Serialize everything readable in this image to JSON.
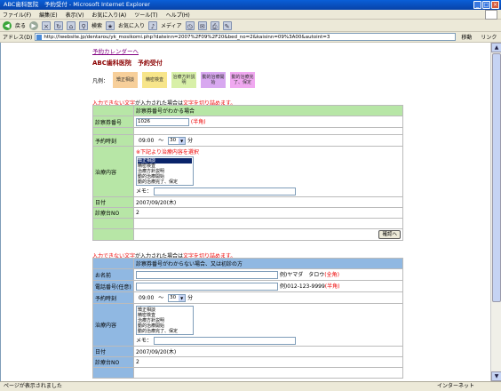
{
  "window": {
    "title": "ABC歯科医院　予約受付 - Microsoft Internet Explorer",
    "menus": [
      "ファイル(F)",
      "編集(E)",
      "表示(V)",
      "お気に入り(A)",
      "ツール(T)",
      "ヘルプ(H)"
    ],
    "toolbar": {
      "back": "戻る",
      "search": "検索",
      "favorites": "お気に入り",
      "media": "メディア"
    },
    "address_label": "アドレス(D)",
    "address": "http://lwebsite.jp/dentarou/yk_mosikomi.php?dateinn=2007%2F09%2F20&bed_no=2&kaisinn=09%3A00&autoint=3",
    "go": "移動",
    "links": "リンク",
    "status": "ページが表示されました",
    "zone": "インターネット"
  },
  "page": {
    "calendar_link": "予約カレンダーへ",
    "clinic_title": "ABC歯科医院　予約受付",
    "legend_label": "凡例：",
    "legend": [
      {
        "label": "矯正相談",
        "color": "#f7cf9a"
      },
      {
        "label": "精密検査",
        "color": "#f7e58a"
      },
      {
        "label": "治療方針説明",
        "color": "#d8f0a8"
      },
      {
        "label": "動的治療開始",
        "color": "#d8a8f0"
      },
      {
        "label": "動的治療完了、保定",
        "color": "#f0a8f0"
      }
    ],
    "warning_pre": "入力できない文字",
    "warning_mid": "が入力された場合は",
    "warning_red": "文字を切り詰めます。",
    "form1": {
      "header": "診察券番号がわかる場合",
      "card_label": "診察券番号",
      "card_value": "1026",
      "card_note": "(半角)",
      "time_label": "予約時刻",
      "time_hour": "09:00",
      "time_sep": "～",
      "time_min": "30",
      "time_unit": "分",
      "treat_label": "治療内容",
      "treat_note": "※下記より治療内容を選択",
      "options": [
        "矯正相談",
        "精密検査",
        "治療方針説明",
        "動的治療開始",
        "動的治療完了、保定"
      ],
      "memo_label": "メモ：",
      "date_label": "日付",
      "date_value": "2007/09/20(木)",
      "bed_label": "診療台NO",
      "bed_value": "2",
      "confirm_button": "確認へ"
    },
    "form2": {
      "header": "診察券番号がわからない場合、又は初診の方",
      "name_label": "お名前",
      "name_example": "例)ヤマダ　タロウ",
      "name_note": "(全角)",
      "phone_label": "電話番号(任意)",
      "phone_example": "例)012-123-9999",
      "phone_note": "(半角)",
      "time_label": "予約時刻",
      "time_hour": "09:00",
      "time_sep": "～",
      "time_min": "30",
      "time_unit": "分",
      "treat_label": "治療内容",
      "options": [
        "矯正相談",
        "精密検査",
        "治療方針説明",
        "動的治療開始",
        "動的治療完了、保定"
      ],
      "memo_label": "メモ：",
      "date_label": "日付",
      "date_value": "2007/09/20(木)",
      "bed_label": "診療台NO",
      "bed_value": "2"
    }
  }
}
